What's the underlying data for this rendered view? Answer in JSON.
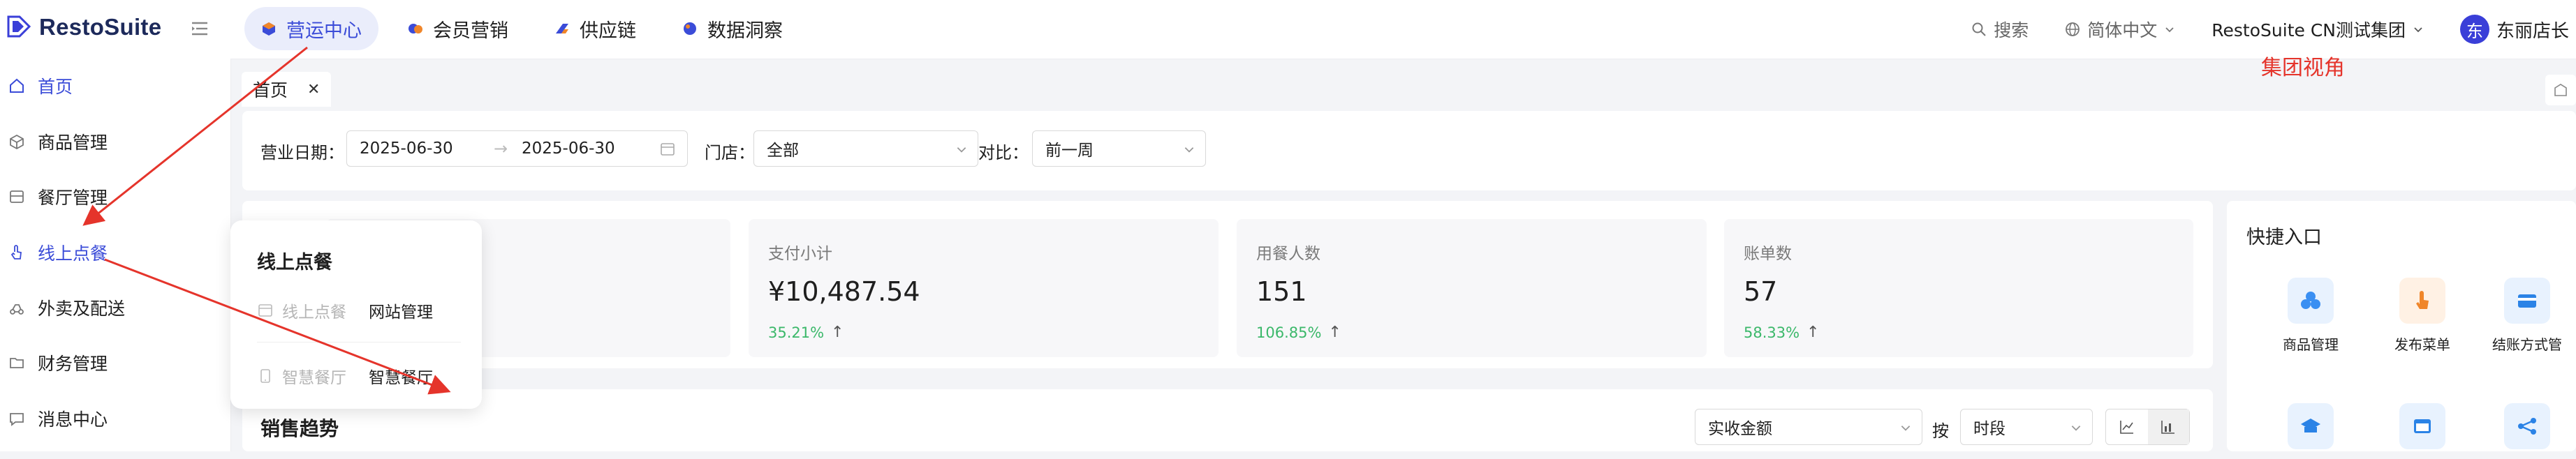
{
  "app": {
    "name": "RestoSuite"
  },
  "topnav": [
    {
      "label": "营运中心",
      "icon": "cube-icon",
      "active": true
    },
    {
      "label": "会员营销",
      "icon": "members-icon",
      "active": false
    },
    {
      "label": "供应链",
      "icon": "supply-icon",
      "active": false
    },
    {
      "label": "数据洞察",
      "icon": "insight-icon",
      "active": false
    }
  ],
  "header": {
    "search_label": "搜索",
    "language": "简体中文",
    "group": "RestoSuite CN测试集团",
    "avatar_initial": "东",
    "user": "东丽店长"
  },
  "annotation": {
    "text": "集团视角",
    "color": "#e5342b"
  },
  "sidebar": {
    "items": [
      {
        "label": "首页",
        "icon": "home-icon"
      },
      {
        "label": "商品管理",
        "icon": "box-icon"
      },
      {
        "label": "餐厅管理",
        "icon": "store-icon"
      },
      {
        "label": "线上点餐",
        "icon": "tap-icon"
      },
      {
        "label": "外卖及配送",
        "icon": "delivery-icon"
      },
      {
        "label": "财务管理",
        "icon": "folder-icon"
      },
      {
        "label": "消息中心",
        "icon": "chat-icon"
      }
    ],
    "active_index": 3
  },
  "tabs": [
    {
      "label": "首页"
    }
  ],
  "filters": {
    "date_label": "营业日期：",
    "date_start": "2025-06-30",
    "date_end": "2025-06-30",
    "store_label": "门店：",
    "store_value": "全部",
    "compare_label": "对比：",
    "compare_value": "前一周"
  },
  "metrics": [
    {
      "label": "支付小计",
      "value": "¥10,487.54",
      "change": "35.21%"
    },
    {
      "label": "用餐人数",
      "value": "151",
      "change": "106.85%"
    },
    {
      "label": "账单数",
      "value": "57",
      "change": "58.33%"
    }
  ],
  "quick_entry": {
    "title": "快捷入口",
    "items": [
      {
        "label": "商品管理",
        "icon": "products-icon",
        "color": "#3a8ff2"
      },
      {
        "label": "发布菜单",
        "icon": "publish-menu-icon",
        "color": "#f0862a"
      },
      {
        "label": "结账方式管",
        "icon": "payment-icon",
        "color": "#2b83e6"
      }
    ],
    "more_icons": [
      "school-icon",
      "window-icon",
      "share-icon"
    ]
  },
  "sales": {
    "title": "销售趋势",
    "metric_select": "实收金额",
    "by_label": "按",
    "period_select": "时段"
  },
  "flyout": {
    "title": "线上点餐",
    "rows": [
      {
        "category": "线上点餐",
        "link": "网站管理"
      },
      {
        "category": "智慧餐厅",
        "link": "智慧餐厅"
      }
    ]
  },
  "colors": {
    "accent": "#3b4cd8",
    "positive": "#3bb86a",
    "annotation": "#e5342b"
  }
}
